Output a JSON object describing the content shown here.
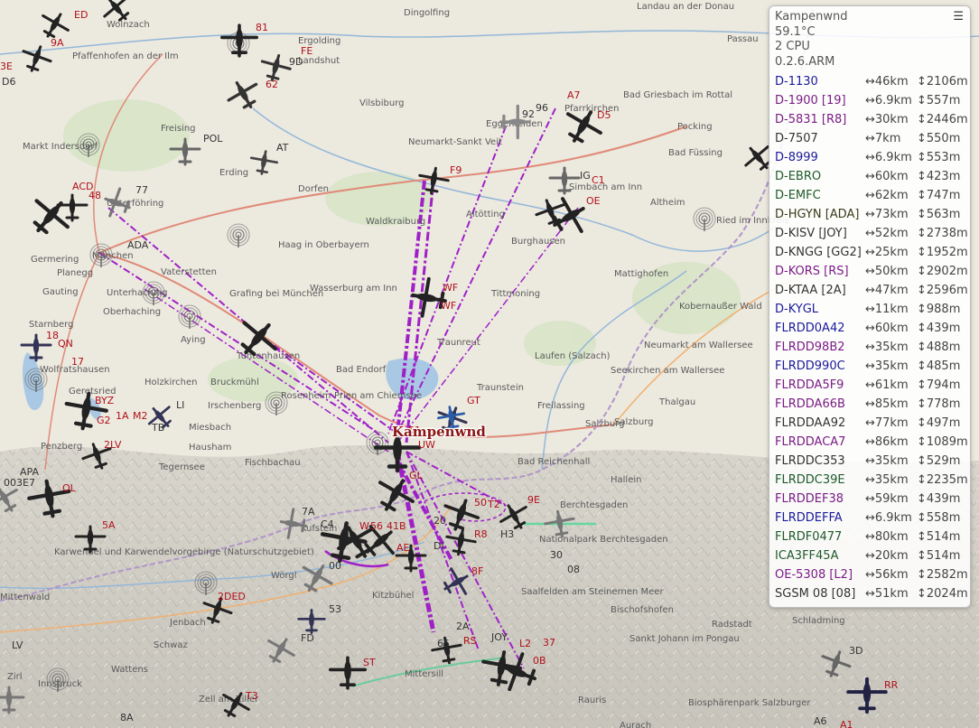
{
  "station": {
    "name": "Kampenwnd",
    "temp": "59.1°C",
    "cpu": "2 CPU",
    "version": "0.2.6.ARM",
    "menu_icon": "hamburger-icon"
  },
  "aircraft_list": [
    {
      "name": "D-1130",
      "dist": "↔46km",
      "alt": "↕2106m",
      "color": "#1a1a9c"
    },
    {
      "name": "D-1900 [19]",
      "dist": "↔6.9km",
      "alt": "↕557m",
      "color": "#7a1c86"
    },
    {
      "name": "D-5831 [R8]",
      "dist": "↔30km",
      "alt": "↕2446m",
      "color": "#7a1c86"
    },
    {
      "name": "D-7507",
      "dist": "↔7km",
      "alt": "↕550m",
      "color": "#333333"
    },
    {
      "name": "D-8999",
      "dist": "↔6.9km",
      "alt": "↕553m",
      "color": "#1a1a9c"
    },
    {
      "name": "D-EBRO",
      "dist": "↔60km",
      "alt": "↕423m",
      "color": "#1e5a2a"
    },
    {
      "name": "D-EMFC",
      "dist": "↔62km",
      "alt": "↕747m",
      "color": "#1e5a2a"
    },
    {
      "name": "D-HGYN [ADA]",
      "dist": "↔73km",
      "alt": "↕563m",
      "color": "#3a3a1a"
    },
    {
      "name": "D-KISV [JOY]",
      "dist": "↔52km",
      "alt": "↕2738m",
      "color": "#333333"
    },
    {
      "name": "D-KNGG [GG2]",
      "dist": "↔25km",
      "alt": "↕1952m",
      "color": "#333333"
    },
    {
      "name": "D-KORS [RS]",
      "dist": "↔50km",
      "alt": "↕2902m",
      "color": "#7a1c86"
    },
    {
      "name": "D-KTAA [2A]",
      "dist": "↔47km",
      "alt": "↕2596m",
      "color": "#333333"
    },
    {
      "name": "D-KYGL",
      "dist": "↔11km",
      "alt": "↕988m",
      "color": "#1a1a9c"
    },
    {
      "name": "FLRDD0A42",
      "dist": "↔60km",
      "alt": "↕439m",
      "color": "#1a1a9c"
    },
    {
      "name": "FLRDD98B2",
      "dist": "↔35km",
      "alt": "↕488m",
      "color": "#7a1c86"
    },
    {
      "name": "FLRDD990C",
      "dist": "↔35km",
      "alt": "↕485m",
      "color": "#1a1a9c"
    },
    {
      "name": "FLRDDA5F9",
      "dist": "↔61km",
      "alt": "↕794m",
      "color": "#7a1c86"
    },
    {
      "name": "FLRDDA66B",
      "dist": "↔85km",
      "alt": "↕778m",
      "color": "#7a1c86"
    },
    {
      "name": "FLRDDAA92",
      "dist": "↔77km",
      "alt": "↕497m",
      "color": "#333333"
    },
    {
      "name": "FLRDDACA7",
      "dist": "↔86km",
      "alt": "↕1089m",
      "color": "#7a1c86"
    },
    {
      "name": "FLRDDC353",
      "dist": "↔35km",
      "alt": "↕529m",
      "color": "#333333"
    },
    {
      "name": "FLRDDC39E",
      "dist": "↔35km",
      "alt": "↕2235m",
      "color": "#1e5a2a"
    },
    {
      "name": "FLRDDEF38",
      "dist": "↔59km",
      "alt": "↕439m",
      "color": "#7a1c86"
    },
    {
      "name": "FLRDDEFFA",
      "dist": "↔6.9km",
      "alt": "↕558m",
      "color": "#1a1a9c"
    },
    {
      "name": "FLRDF0477",
      "dist": "↔80km",
      "alt": "↕514m",
      "color": "#1e5a2a"
    },
    {
      "name": "ICA3FF45A",
      "dist": "↔20km",
      "alt": "↕514m",
      "color": "#1e5a2a"
    },
    {
      "name": "OE-5308 [L2]",
      "dist": "↔56km",
      "alt": "↕2582m",
      "color": "#7a1c86"
    },
    {
      "name": "SGSM 08 [08]",
      "dist": "↔51km",
      "alt": "↕2024m",
      "color": "#333333"
    }
  ],
  "places": [
    "Dingolfing",
    "Wolnzach",
    "Landau an der Donau",
    "Passau",
    "Pfaffenhofen an der Ilm",
    "Ergolding",
    "Landshut",
    "Bad Griesbach im Rottal",
    "Vilsbiburg",
    "Eggenfelden",
    "Freising",
    "Markt Indersdorf",
    "Neumarkt-Sankt Veit",
    "Pfarrkirchen",
    "Pocking",
    "Bad Füssing",
    "Erding",
    "Dorfen",
    "Simbach am Inn",
    "Altheim",
    "Ried im Innkreis",
    "Unterföhring",
    "Waldkraiburg",
    "Altötting",
    "Burghausen",
    "Germering",
    "Planegg",
    "Haag in Oberbayern",
    "Vaterstetten",
    "Wasserburg am Inn",
    "Mattighofen",
    "Gauting",
    "Unterhaching",
    "Grafing bei München",
    "Tittmoning",
    "Kobernaußer Wald",
    "Oberhaching",
    "Aying",
    "Traunreut",
    "Starnberg",
    "Wolfratshausen",
    "Tuntenhausen",
    "Neumarkt am Wallersee",
    "Bad Endorf",
    "Laufen (Salzach)",
    "Seekirchen am Wallersee",
    "Holzkirchen",
    "Bruckmühl",
    "Traunstein",
    "Rosenheim",
    "Prien am Chiemsee",
    "Irschenberg",
    "Geretsried",
    "Freilassing",
    "Thalgau",
    "Miesbach",
    "Salzburg",
    "Penzberg",
    "Hausham",
    "Fischbachau",
    "Bad Reichenhall",
    "Tegernsee",
    "Hallein",
    "Berchtesgaden",
    "Nationalpark Berchtesgaden",
    "Kufstein",
    "Wörgl",
    "Saalfelden am Steinernen Meer",
    "Bischofshofen",
    "Mittenwald",
    "Jenbach",
    "Kitzbühel",
    "Schwaz",
    "Radstadt",
    "Schladming",
    "Sankt Johann im Pongau",
    "Wattens",
    "Mittersill",
    "Innsbruck",
    "Zell am Ziller",
    "Rauris",
    "Biosphärenpark Salzburger",
    "Karwendel und Karwendelvorgebirge (Naturschutzgebiet)",
    "Salzburg",
    "Zirl",
    "Aurach",
    "München"
  ],
  "tags": [
    "ED",
    "9A",
    "3E",
    "D6",
    "81",
    "FE",
    "9D",
    "62",
    "POL",
    "AT",
    "96",
    "A7",
    "D5",
    "92",
    "C1",
    "IG",
    "OE",
    "F9",
    "ACD",
    "48",
    "77",
    "ADA",
    "WF",
    "WF",
    "18",
    "QN",
    "GT",
    "BYZ",
    "1A",
    "M2",
    "LI",
    "TB",
    "G2",
    "2LV",
    "51",
    "UW",
    "GL",
    "OL",
    "5A",
    "7A",
    "W",
    "56",
    "41",
    "B",
    "AE",
    "20",
    "50",
    "T2",
    "9E",
    "R8",
    "H3",
    "30",
    "08",
    "8F",
    "2DED",
    "53",
    "FD",
    "2A",
    "JOY",
    "RS",
    "65",
    "L2",
    "37",
    "0B",
    "ST",
    "T3",
    "8A",
    "3D",
    "RR",
    "A6",
    "A1",
    "00",
    "DI",
    "C4",
    "LV",
    "17",
    "003",
    "E7",
    "APA"
  ],
  "station_temp_label": "Kampenwnd"
}
